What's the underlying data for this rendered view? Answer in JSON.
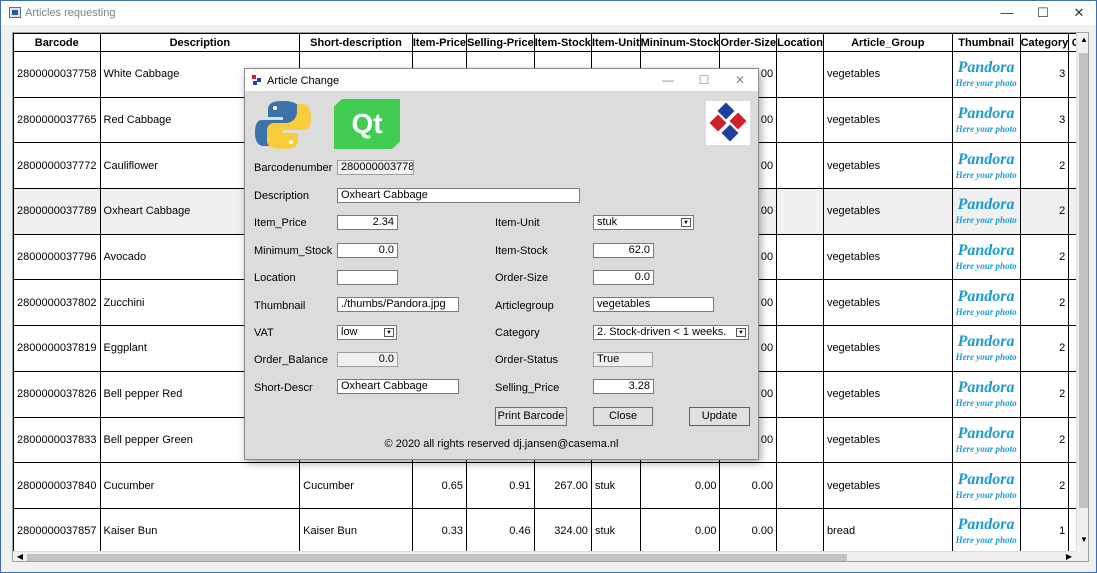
{
  "window": {
    "title": "Articles requesting",
    "minimize": "—",
    "maximize": "☐",
    "close": "✕"
  },
  "table": {
    "headers": [
      "Barcode",
      "Description",
      "Short-description",
      "Item-Price",
      "Selling-Price",
      "Item-Stock",
      "Item-Unit",
      "Mininum-Stock",
      "Order-Size",
      "Location",
      "Article_Group",
      "Thumbnail",
      "Category",
      "Or"
    ],
    "thumb_brand": "Pandora",
    "thumb_caption": "Here your photo",
    "rows": [
      {
        "barcode": "2800000037758",
        "description": "White Cabbage",
        "short": "",
        "price": "",
        "selling": "",
        "stock": "",
        "unit": "",
        "min_stock": "",
        "order_size": "00",
        "location": "",
        "group": "vegetables",
        "category": "3"
      },
      {
        "barcode": "2800000037765",
        "description": "Red Cabbage",
        "short": "",
        "price": "",
        "selling": "",
        "stock": "",
        "unit": "",
        "min_stock": "",
        "order_size": "00",
        "location": "",
        "group": "vegetables",
        "category": "3"
      },
      {
        "barcode": "2800000037772",
        "description": "Cauliflower",
        "short": "",
        "price": "",
        "selling": "",
        "stock": "",
        "unit": "",
        "min_stock": "",
        "order_size": "00",
        "location": "",
        "group": "vegetables",
        "category": "2"
      },
      {
        "barcode": "2800000037789",
        "description": "Oxheart Cabbage",
        "short": "",
        "price": "",
        "selling": "",
        "stock": "",
        "unit": "",
        "min_stock": "",
        "order_size": "00",
        "location": "",
        "group": "vegetables",
        "category": "2"
      },
      {
        "barcode": "2800000037796",
        "description": "Avocado",
        "short": "",
        "price": "",
        "selling": "",
        "stock": "",
        "unit": "",
        "min_stock": "",
        "order_size": "00",
        "location": "",
        "group": "vegetables",
        "category": "2"
      },
      {
        "barcode": "2800000037802",
        "description": "Zucchini",
        "short": "",
        "price": "",
        "selling": "",
        "stock": "",
        "unit": "",
        "min_stock": "",
        "order_size": "00",
        "location": "",
        "group": "vegetables",
        "category": "2"
      },
      {
        "barcode": "2800000037819",
        "description": "Eggplant",
        "short": "",
        "price": "",
        "selling": "",
        "stock": "",
        "unit": "",
        "min_stock": "",
        "order_size": "00",
        "location": "",
        "group": "vegetables",
        "category": "2"
      },
      {
        "barcode": "2800000037826",
        "description": "Bell pepper Red",
        "short": "",
        "price": "",
        "selling": "",
        "stock": "",
        "unit": "",
        "min_stock": "",
        "order_size": "00",
        "location": "",
        "group": "vegetables",
        "category": "2"
      },
      {
        "barcode": "2800000037833",
        "description": "Bell pepper Green",
        "short": "",
        "price": "",
        "selling": "",
        "stock": "",
        "unit": "",
        "min_stock": "",
        "order_size": "00",
        "location": "",
        "group": "vegetables",
        "category": "2"
      },
      {
        "barcode": "2800000037840",
        "description": "Cucumber",
        "short": "Cucumber",
        "price": "0.65",
        "selling": "0.91",
        "stock": "267.00",
        "unit": "stuk",
        "min_stock": "0.00",
        "order_size": "0.00",
        "location": "",
        "group": "vegetables",
        "category": "2"
      },
      {
        "barcode": "2800000037857",
        "description": "Kaiser Bun",
        "short": "Kaiser Bun",
        "price": "0.33",
        "selling": "0.46",
        "stock": "324.00",
        "unit": "stuk",
        "min_stock": "0.00",
        "order_size": "0.00",
        "location": "",
        "group": "bread",
        "category": "1"
      }
    ],
    "selected_row": 3
  },
  "dialog": {
    "title": "Article Change",
    "minimize": "—",
    "maximize": "☐",
    "close": "✕",
    "logo_qt": "Qt",
    "labels": {
      "barcode": "Barcodenumber",
      "description": "Description",
      "item_price": "Item_Price",
      "minimum_stock": "Minimum_Stock",
      "location": "Location",
      "thumbnail": "Thumbnail",
      "vat": "VAT",
      "order_balance": "Order_Balance",
      "short_descr": "Short-Descr",
      "item_unit": "Item-Unit",
      "item_stock": "Item-Stock",
      "order_size": "Order-Size",
      "articlegroup": "Articlegroup",
      "category": "Category",
      "order_status": "Order-Status",
      "selling_price": "Selling_Price"
    },
    "values": {
      "barcode": "2800000037789",
      "description": "Oxheart Cabbage",
      "item_price": "2.34",
      "minimum_stock": "0.0",
      "location": "",
      "thumbnail": "./thumbs/Pandora.jpg",
      "vat": "low",
      "order_balance": "0.0",
      "short_descr": "Oxheart Cabbage",
      "item_unit": "stuk",
      "item_stock": "62.0",
      "order_size": "0.0",
      "articlegroup": "vegetables",
      "category": "2. Stock-driven < 1 weeks.",
      "order_status": "True",
      "selling_price": "3.28"
    },
    "buttons": {
      "print_barcode": "Print Barcode",
      "close": "Close",
      "update": "Update"
    },
    "copyright": "© 2020 all rights reserved dj.jansen@casema.nl"
  }
}
